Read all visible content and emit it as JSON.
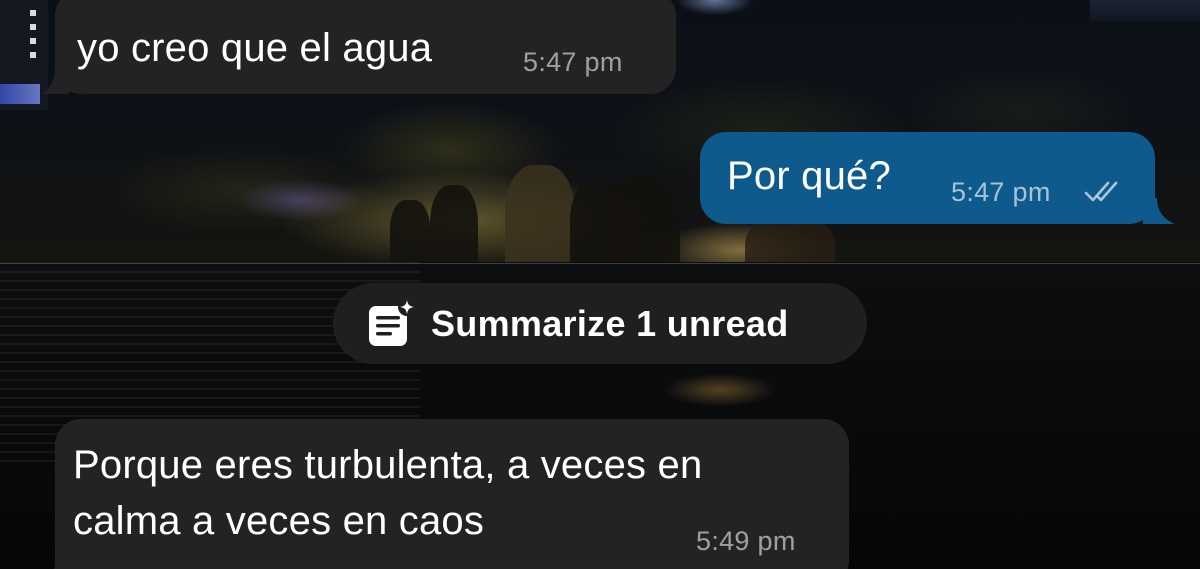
{
  "chat": {
    "messages": [
      {
        "direction": "incoming",
        "text": "yo creo que el agua",
        "time": "5:47 pm"
      },
      {
        "direction": "outgoing",
        "text": "Por qué?",
        "time": "5:47 pm",
        "status": "read-double-check"
      },
      {
        "direction": "incoming",
        "text": "Porque eres turbulenta, a veces en\ncalma a veces en caos",
        "time": "5:49 pm"
      }
    ],
    "summarize": {
      "label": "Summarize 1 unread",
      "icon": "summarize-sparkle-icon"
    }
  },
  "colors": {
    "incoming_bubble": "#232323",
    "outgoing_bubble": "#0e5a8c",
    "pill_background": "#1f1f1f",
    "text": "#ffffff"
  }
}
